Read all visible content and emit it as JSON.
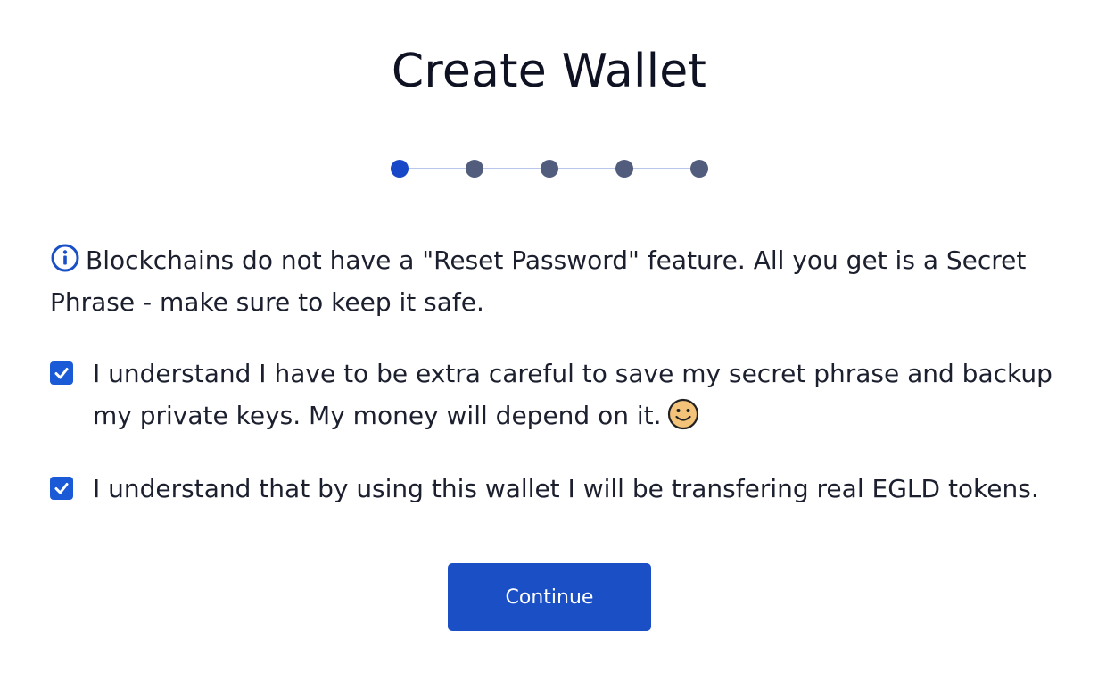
{
  "page": {
    "title": "Create Wallet"
  },
  "stepper": {
    "total_steps": 5,
    "current_step": 1,
    "active_color": "#1847c7",
    "inactive_color": "#525c7c"
  },
  "notice": {
    "icon": "info-circle-icon",
    "text": "Blockchains do not have a \"Reset Password\" feature. All you get is a Secret Phrase - make sure to keep it safe."
  },
  "checks": [
    {
      "checked": true,
      "label": "I understand I have to be extra careful to save my secret phrase and backup my private keys. My money will depend on it.",
      "emoji": "smiling-face-icon"
    },
    {
      "checked": true,
      "label": "I understand that by using this wallet I will be transfering real EGLD tokens."
    }
  ],
  "actions": {
    "continue_label": "Continue"
  },
  "colors": {
    "accent": "#1a4fc6",
    "checkbox": "#1a5ad7",
    "text": "#1b1f2e"
  }
}
